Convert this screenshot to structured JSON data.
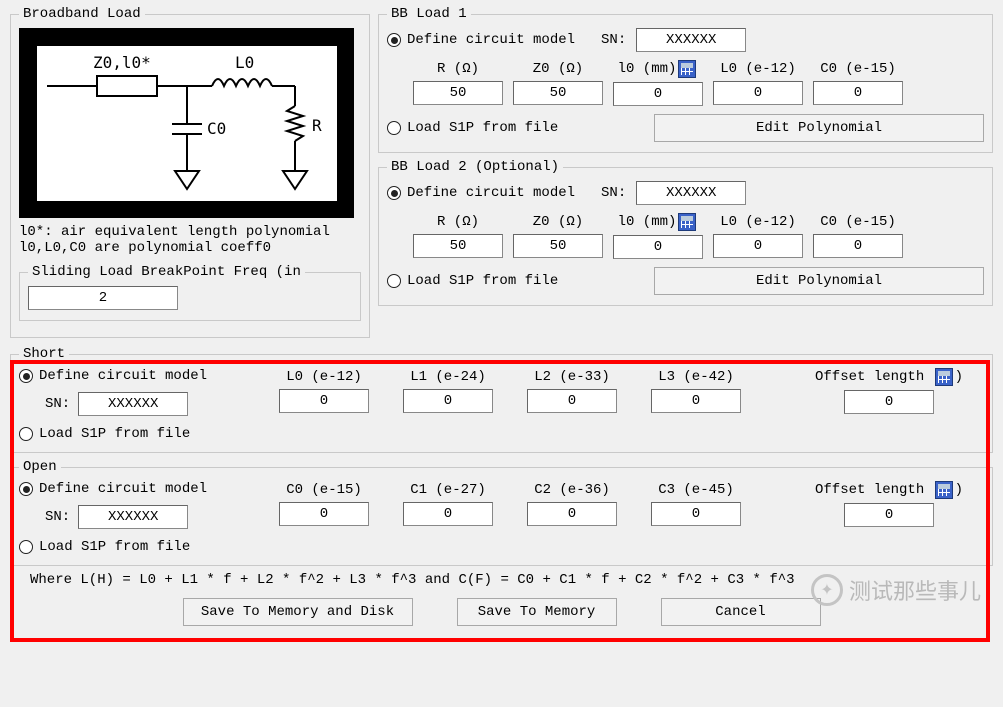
{
  "broadband": {
    "legend": "Broadband Load",
    "diagram_labels": {
      "z0": "Z0,l0*",
      "l0": "L0",
      "c0": "C0",
      "r": "R"
    },
    "note1": "l0*: air equivalent length polynomial",
    "note2": "l0,L0,C0 are polynomial coeff0",
    "sliding_label": "Sliding Load BreakPoint Freq (in",
    "sliding_value": "2"
  },
  "bb1": {
    "legend": "BB Load 1",
    "define": "Define circuit model",
    "sn_label": "SN:",
    "sn_value": "XXXXXX",
    "r_label": "R (Ω)",
    "r_value": "50",
    "z0_label": "Z0 (Ω)",
    "z0_value": "50",
    "l0_label": "l0 (mm)",
    "l0_value": "0",
    "L0_label": "L0 (e-12)",
    "L0_value": "0",
    "C0_label": "C0 (e-15)",
    "C0_value": "0",
    "load_s1p": "Load S1P from file",
    "edit_poly": "Edit Polynomial"
  },
  "bb2": {
    "legend": "BB Load 2 (Optional)",
    "define": "Define circuit model",
    "sn_label": "SN:",
    "sn_value": "XXXXXX",
    "r_label": "R (Ω)",
    "r_value": "50",
    "z0_label": "Z0 (Ω)",
    "z0_value": "50",
    "l0_label": "l0 (mm)",
    "l0_value": "0",
    "L0_label": "L0 (e-12)",
    "L0_value": "0",
    "C0_label": "C0 (e-15)",
    "C0_value": "0",
    "load_s1p": "Load S1P from file",
    "edit_poly": "Edit Polynomial"
  },
  "short": {
    "legend": "Short",
    "define": "Define circuit model",
    "sn_label": "SN:",
    "sn_value": "XXXXXX",
    "L0_label": "L0 (e-12)",
    "L0_value": "0",
    "L1_label": "L1 (e-24)",
    "L1_value": "0",
    "L2_label": "L2 (e-33)",
    "L2_value": "0",
    "L3_label": "L3 (e-42)",
    "L3_value": "0",
    "offset_label": "Offset length",
    "offset_suffix": ")",
    "offset_value": "0",
    "load_s1p": "Load S1P from file"
  },
  "open": {
    "legend": "Open",
    "define": "Define circuit model",
    "sn_label": "SN:",
    "sn_value": "XXXXXX",
    "C0_label": "C0 (e-15)",
    "C0_value": "0",
    "C1_label": "C1 (e-27)",
    "C1_value": "0",
    "C2_label": "C2 (e-36)",
    "C2_value": "0",
    "C3_label": "C3 (e-45)",
    "C3_value": "0",
    "offset_label": "Offset length",
    "offset_suffix": ")",
    "offset_value": "0",
    "load_s1p": "Load S1P from file"
  },
  "formula": "Where L(H) = L0 + L1 * f + L2 * f^2 + L3 * f^3  and  C(F) = C0 + C1 * f + C2 * f^2 + C3 * f^3",
  "buttons": {
    "save_mem_disk": "Save To Memory and Disk",
    "save_mem": "Save To Memory",
    "cancel": "Cancel"
  },
  "watermark": "测试那些事儿"
}
